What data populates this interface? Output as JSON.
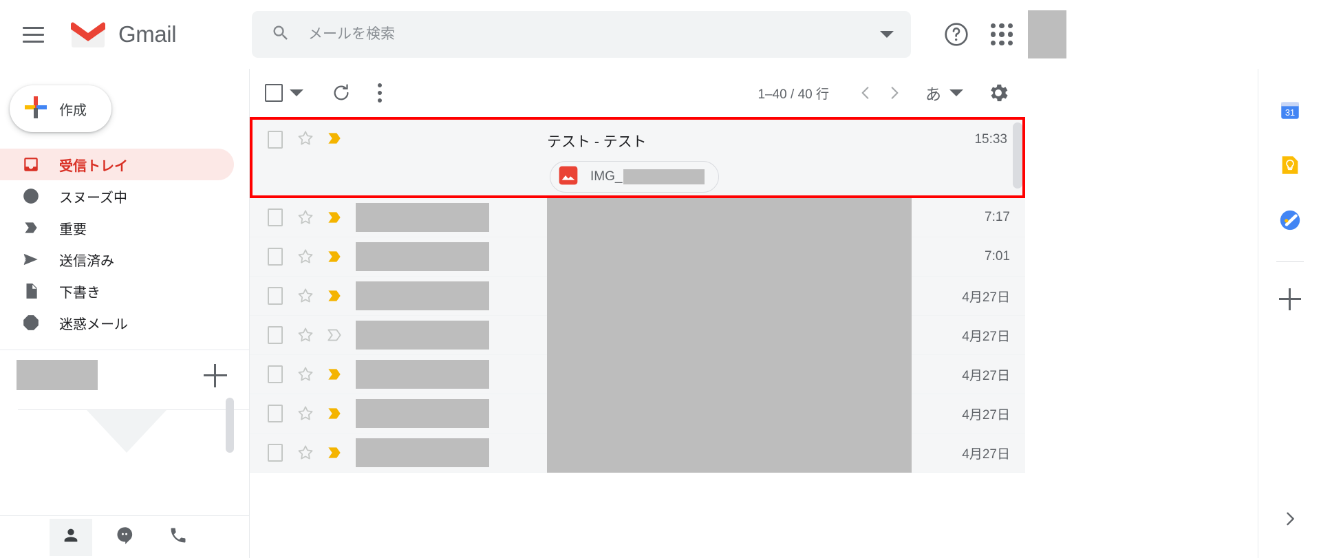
{
  "header": {
    "menu_icon": "hamburger-menu-icon",
    "logo_icon": "gmail-logo-icon",
    "brand": "Gmail",
    "search": {
      "icon": "search-icon",
      "placeholder": "メールを検索",
      "value": "",
      "options_icon": "chevron-down-icon"
    },
    "help_icon": "help-circle-icon",
    "apps_icon": "apps-grid-icon",
    "avatar": "avatar-redacted"
  },
  "sidebar": {
    "compose": {
      "label": "作成",
      "icon": "plus-icon"
    },
    "items": [
      {
        "label": "受信トレイ",
        "icon": "inbox-icon",
        "active": true
      },
      {
        "label": "スヌーズ中",
        "icon": "clock-icon",
        "active": false
      },
      {
        "label": "重要",
        "icon": "important-chevron-icon",
        "active": false
      },
      {
        "label": "送信済み",
        "icon": "send-arrow-icon",
        "active": false
      },
      {
        "label": "下書き",
        "icon": "draft-page-icon",
        "active": false
      },
      {
        "label": "迷惑メール",
        "icon": "spam-exclamation-icon",
        "active": false
      }
    ],
    "hangouts": {
      "account_name_redacted": "",
      "add_icon": "plus-icon",
      "tabs": [
        {
          "icon": "person-icon",
          "selected": true
        },
        {
          "icon": "chat-bubble-icon",
          "selected": false
        },
        {
          "icon": "phone-icon",
          "selected": false
        }
      ]
    }
  },
  "toolbar": {
    "select_all_icon": "checkbox-icon",
    "select_all_caret_icon": "chevron-down-icon",
    "refresh_icon": "refresh-icon",
    "more_icon": "more-vertical-icon",
    "count_text": "1–40 / 40 行",
    "prev_icon": "chevron-left-icon",
    "next_icon": "chevron-right-icon",
    "input_tool_label": "あ",
    "input_tool_caret_icon": "chevron-down-icon",
    "settings_icon": "gear-icon"
  },
  "mail_list": {
    "featured": {
      "checkbox_icon": "checkbox-icon",
      "star_icon": "star-outline-icon",
      "important_icon": "important-chevron-icon",
      "sender_redacted": "",
      "subject": "テスト - テスト",
      "date": "15:33",
      "attachment": {
        "icon": "image-file-icon",
        "name_prefix": "IMG_",
        "name_redacted": ""
      }
    },
    "rows": [
      {
        "checkbox_icon": "checkbox-icon",
        "star_icon": "star-outline-icon",
        "important_icon": "important-chevron-icon",
        "date": "7:17",
        "redacted": true
      },
      {
        "checkbox_icon": "checkbox-icon",
        "star_icon": "star-outline-icon",
        "important_icon": "important-chevron-icon",
        "date": "7:01",
        "redacted": true
      },
      {
        "checkbox_icon": "checkbox-icon",
        "star_icon": "star-outline-icon",
        "important_icon": "important-chevron-icon",
        "date": "4月27日",
        "redacted": true
      },
      {
        "checkbox_icon": "checkbox-icon",
        "star_icon": "star-outline-icon",
        "important_icon": "important-chevron-outline-icon",
        "date": "4月27日",
        "redacted": true
      },
      {
        "checkbox_icon": "checkbox-icon",
        "star_icon": "star-outline-icon",
        "important_icon": "important-chevron-icon",
        "date": "4月27日",
        "redacted": true
      },
      {
        "checkbox_icon": "checkbox-icon",
        "star_icon": "star-outline-icon",
        "important_icon": "important-chevron-icon",
        "date": "4月27日",
        "redacted": true
      },
      {
        "checkbox_icon": "checkbox-icon",
        "star_icon": "star-outline-icon",
        "important_icon": "important-chevron-icon",
        "date": "4月27日",
        "redacted": true
      }
    ]
  },
  "right_panel": {
    "items": [
      {
        "icon": "google-calendar-icon"
      },
      {
        "icon": "google-keep-icon"
      },
      {
        "icon": "google-tasks-icon"
      }
    ],
    "add_icon": "plus-icon",
    "expand_icon": "chevron-right-icon"
  },
  "colors": {
    "brand_red": "#d93025",
    "accent_yellow": "#f4b400",
    "highlight_border": "#ff0000",
    "active_nav_bg": "#fce8e6",
    "redacted": "#bdbdbd"
  }
}
